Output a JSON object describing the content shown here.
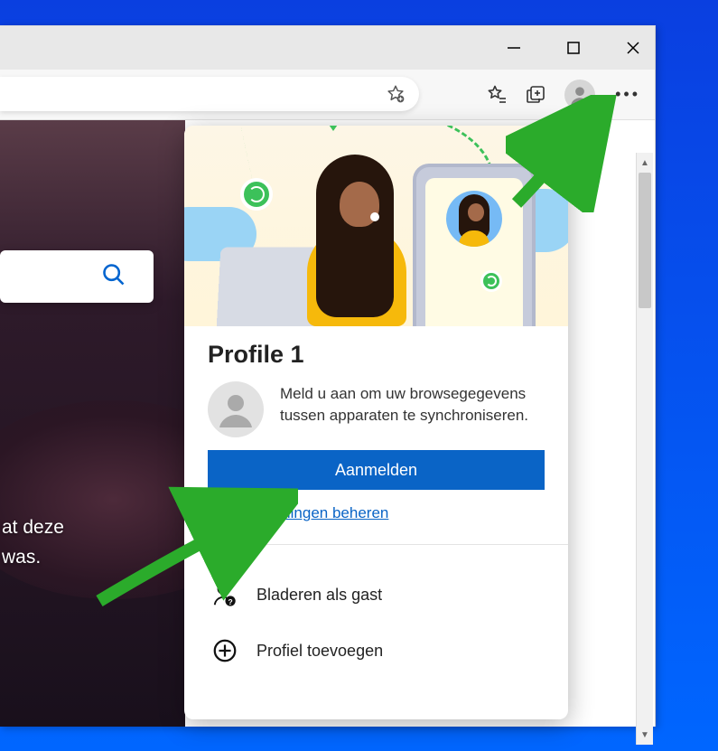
{
  "window": {
    "titlebar": {
      "minimize_title": "Minimize",
      "maximize_title": "Maximize",
      "close_title": "Close"
    },
    "toolbar": {
      "add_favorite_title": "Add this page to favorites",
      "favorites_title": "Favorites",
      "collections_title": "Collections",
      "profile_title": "Profile",
      "menu_title": "Settings and more"
    }
  },
  "homepage": {
    "caption_line1": "at deze",
    "caption_line2": "was."
  },
  "popover": {
    "profile_name": "Profile 1",
    "description": "Meld u aan om uw browsegegevens tussen apparaten te synchroniseren.",
    "signin_label": "Aanmelden",
    "manage_link": "Profielinstellingen beheren",
    "guest_label": "Bladeren als gast",
    "add_profile_label": "Profiel toevoegen"
  },
  "icons": {
    "search": "search-icon",
    "avatar": "avatar-icon",
    "guest": "guest-badge-icon",
    "add": "plus-circle-icon"
  },
  "colors": {
    "primary": "#0a64c6",
    "accent_green": "#3cc15a"
  }
}
